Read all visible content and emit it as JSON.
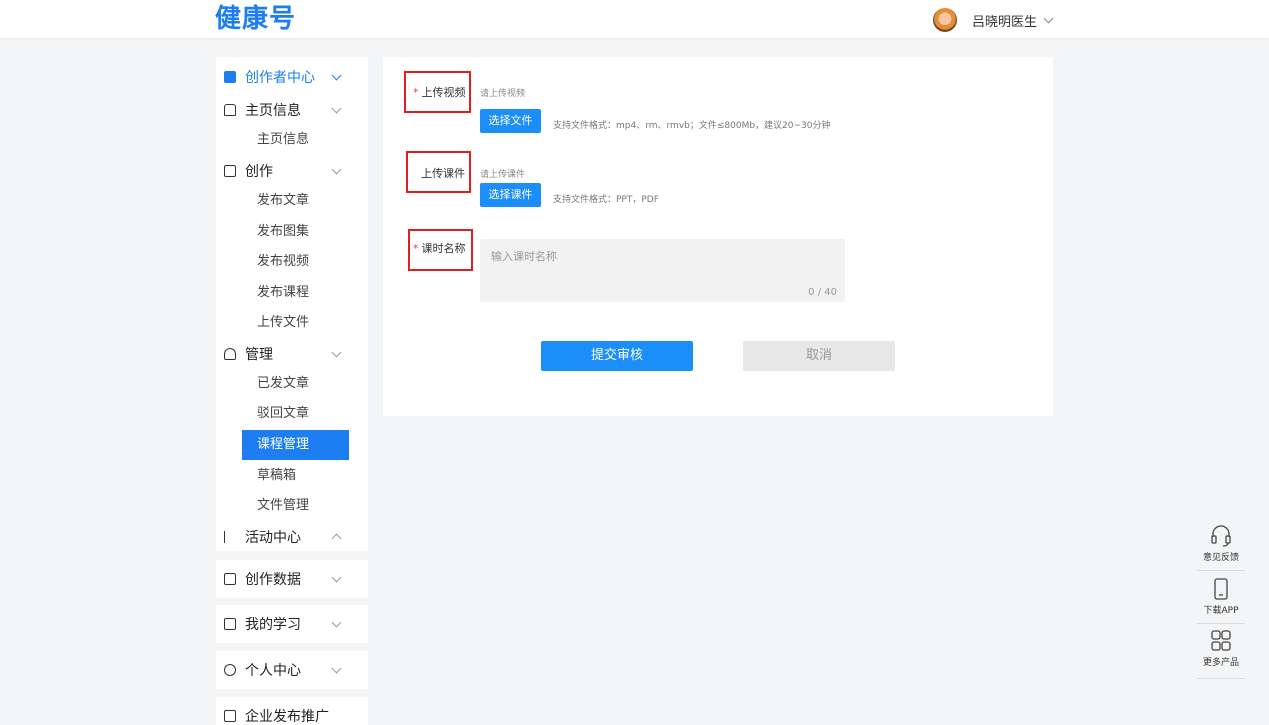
{
  "header": {
    "logo": "健康号",
    "user_name": "吕晓明医生"
  },
  "sidebar": {
    "creator_center": "创作者中心",
    "homepage_info": "主页信息",
    "homepage_info_sub": "主页信息",
    "create": "创作",
    "create_items": [
      "发布文章",
      "发布图集",
      "发布视频",
      "发布课程",
      "上传文件"
    ],
    "manage": "管理",
    "manage_items": [
      "已发文章",
      "驳回文章",
      "课程管理",
      "草稿箱",
      "文件管理"
    ],
    "active_item": "课程管理",
    "activity_center": "活动中心",
    "creation_data": "创作数据",
    "my_learning": "我的学习",
    "personal_center": "个人中心",
    "enterprise_promo": "企业发布推广"
  },
  "form": {
    "upload_video_label": "上传视频",
    "upload_video_hint": "请上传视频",
    "select_file_btn": "选择文件",
    "video_support": "支持文件格式：mp4、rm、rmvb；文件≤800Mb，建议20~30分钟",
    "upload_courseware_label": "上传课件",
    "upload_courseware_hint": "请上传课件",
    "select_courseware_btn": "选择课件",
    "courseware_support": "支持文件格式：PPT，PDF",
    "lesson_name_label": "课时名称",
    "lesson_name_placeholder": "输入课时名称",
    "lesson_name_count": "0 / 40",
    "submit_btn": "提交审核",
    "cancel_btn": "取消",
    "required_mark": "*"
  },
  "tools": {
    "feedback": "意见反馈",
    "download_app": "下载APP",
    "more_products": "更多产品"
  },
  "colors": {
    "brand": "#1c7ef0",
    "button": "#1c8ef9",
    "highlight_box": "#e02020"
  }
}
